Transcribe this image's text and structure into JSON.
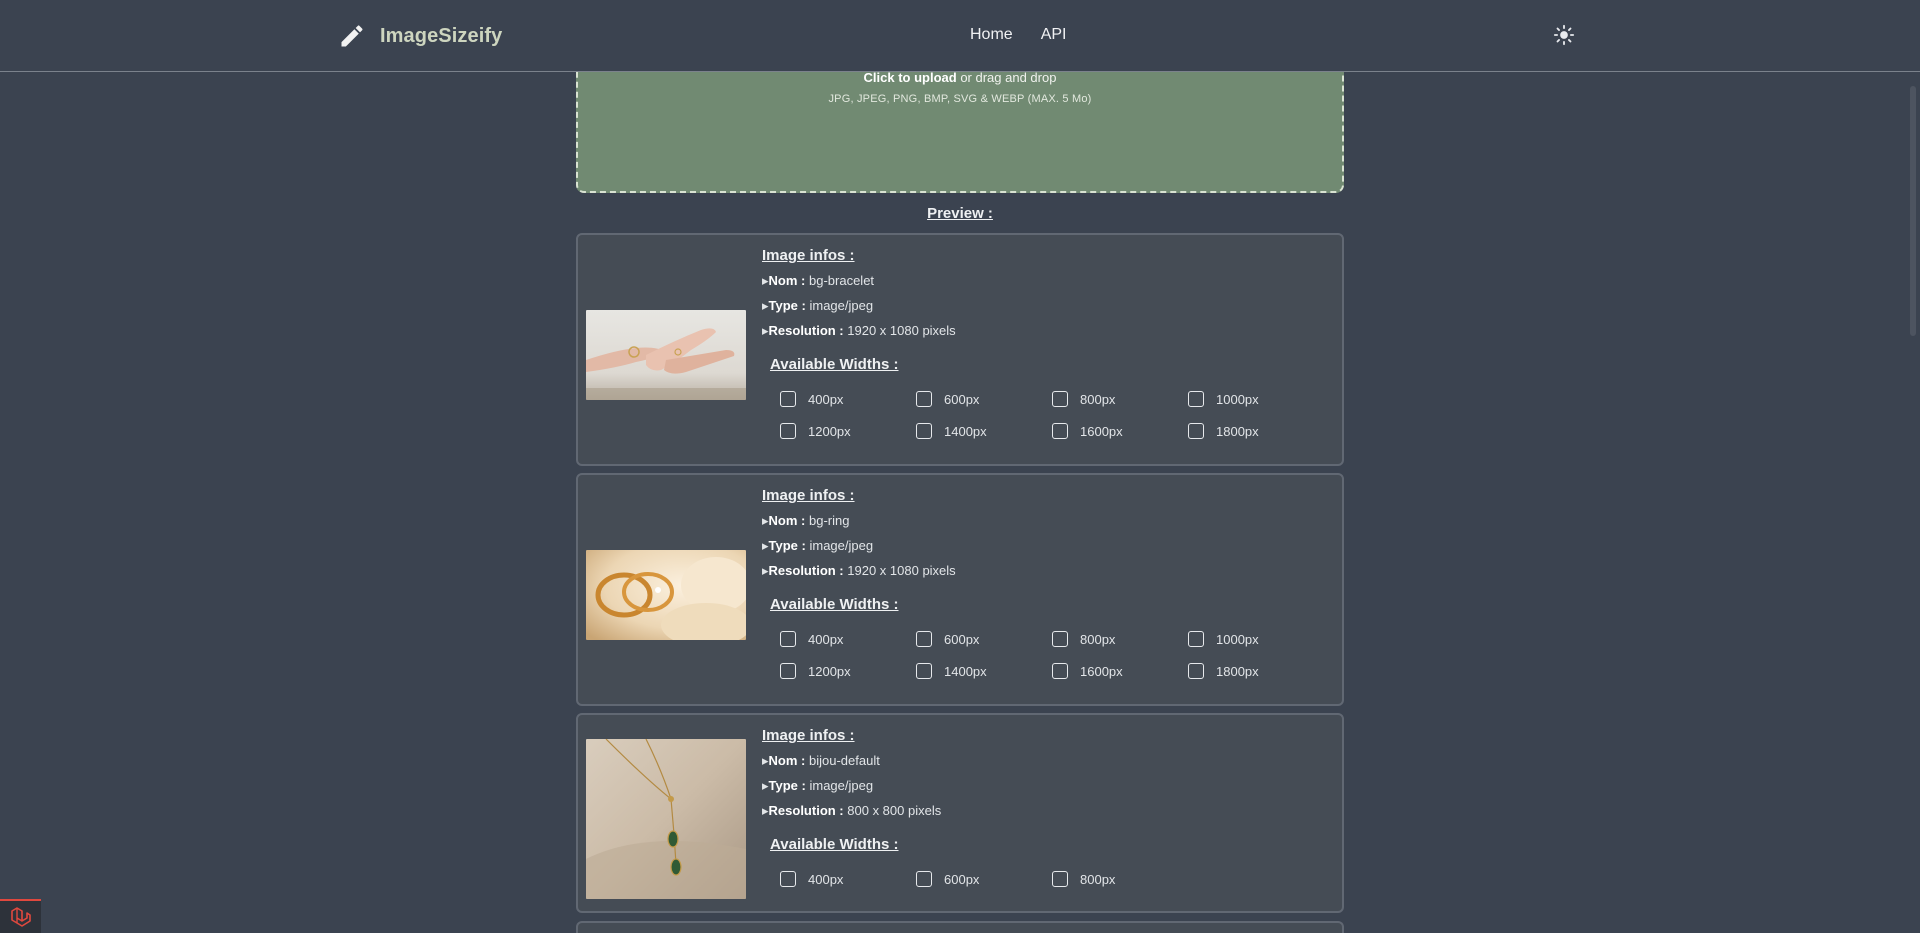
{
  "header": {
    "brand": "ImageSizeify",
    "nav": [
      {
        "label": "Home"
      },
      {
        "label": "API"
      }
    ],
    "theme_icon": "sun-icon",
    "brand_icon": "pencil-icon"
  },
  "upload": {
    "cta_bold": "Click to upload",
    "cta_rest": " or drag and drop",
    "formats": "JPG, JPEG, PNG, BMP, SVG & WEBP (MAX. 5 Mo)"
  },
  "preview_title": "Preview :",
  "labels": {
    "info_title": "Image infos :",
    "nom": "Nom :",
    "type": "Type :",
    "resolution": "Resolution :",
    "widths_title": "Available Widths :"
  },
  "images": [
    {
      "nom": "bg-bracelet",
      "type": "image/jpeg",
      "resolution": "1920 x 1080 pixels",
      "widths": [
        "400px",
        "600px",
        "800px",
        "1000px",
        "1200px",
        "1400px",
        "1600px",
        "1800px"
      ]
    },
    {
      "nom": "bg-ring",
      "type": "image/jpeg",
      "resolution": "1920 x 1080 pixels",
      "widths": [
        "400px",
        "600px",
        "800px",
        "1000px",
        "1200px",
        "1400px",
        "1600px",
        "1800px"
      ]
    },
    {
      "nom": "bijou-default",
      "type": "image/jpeg",
      "resolution": "800 x 800 pixels",
      "widths": [
        "400px",
        "600px",
        "800px"
      ]
    }
  ],
  "colors": {
    "background": "#3b4350",
    "card": "#454c55",
    "dropzone": "#718a72",
    "brand": "#cdd5bf"
  }
}
